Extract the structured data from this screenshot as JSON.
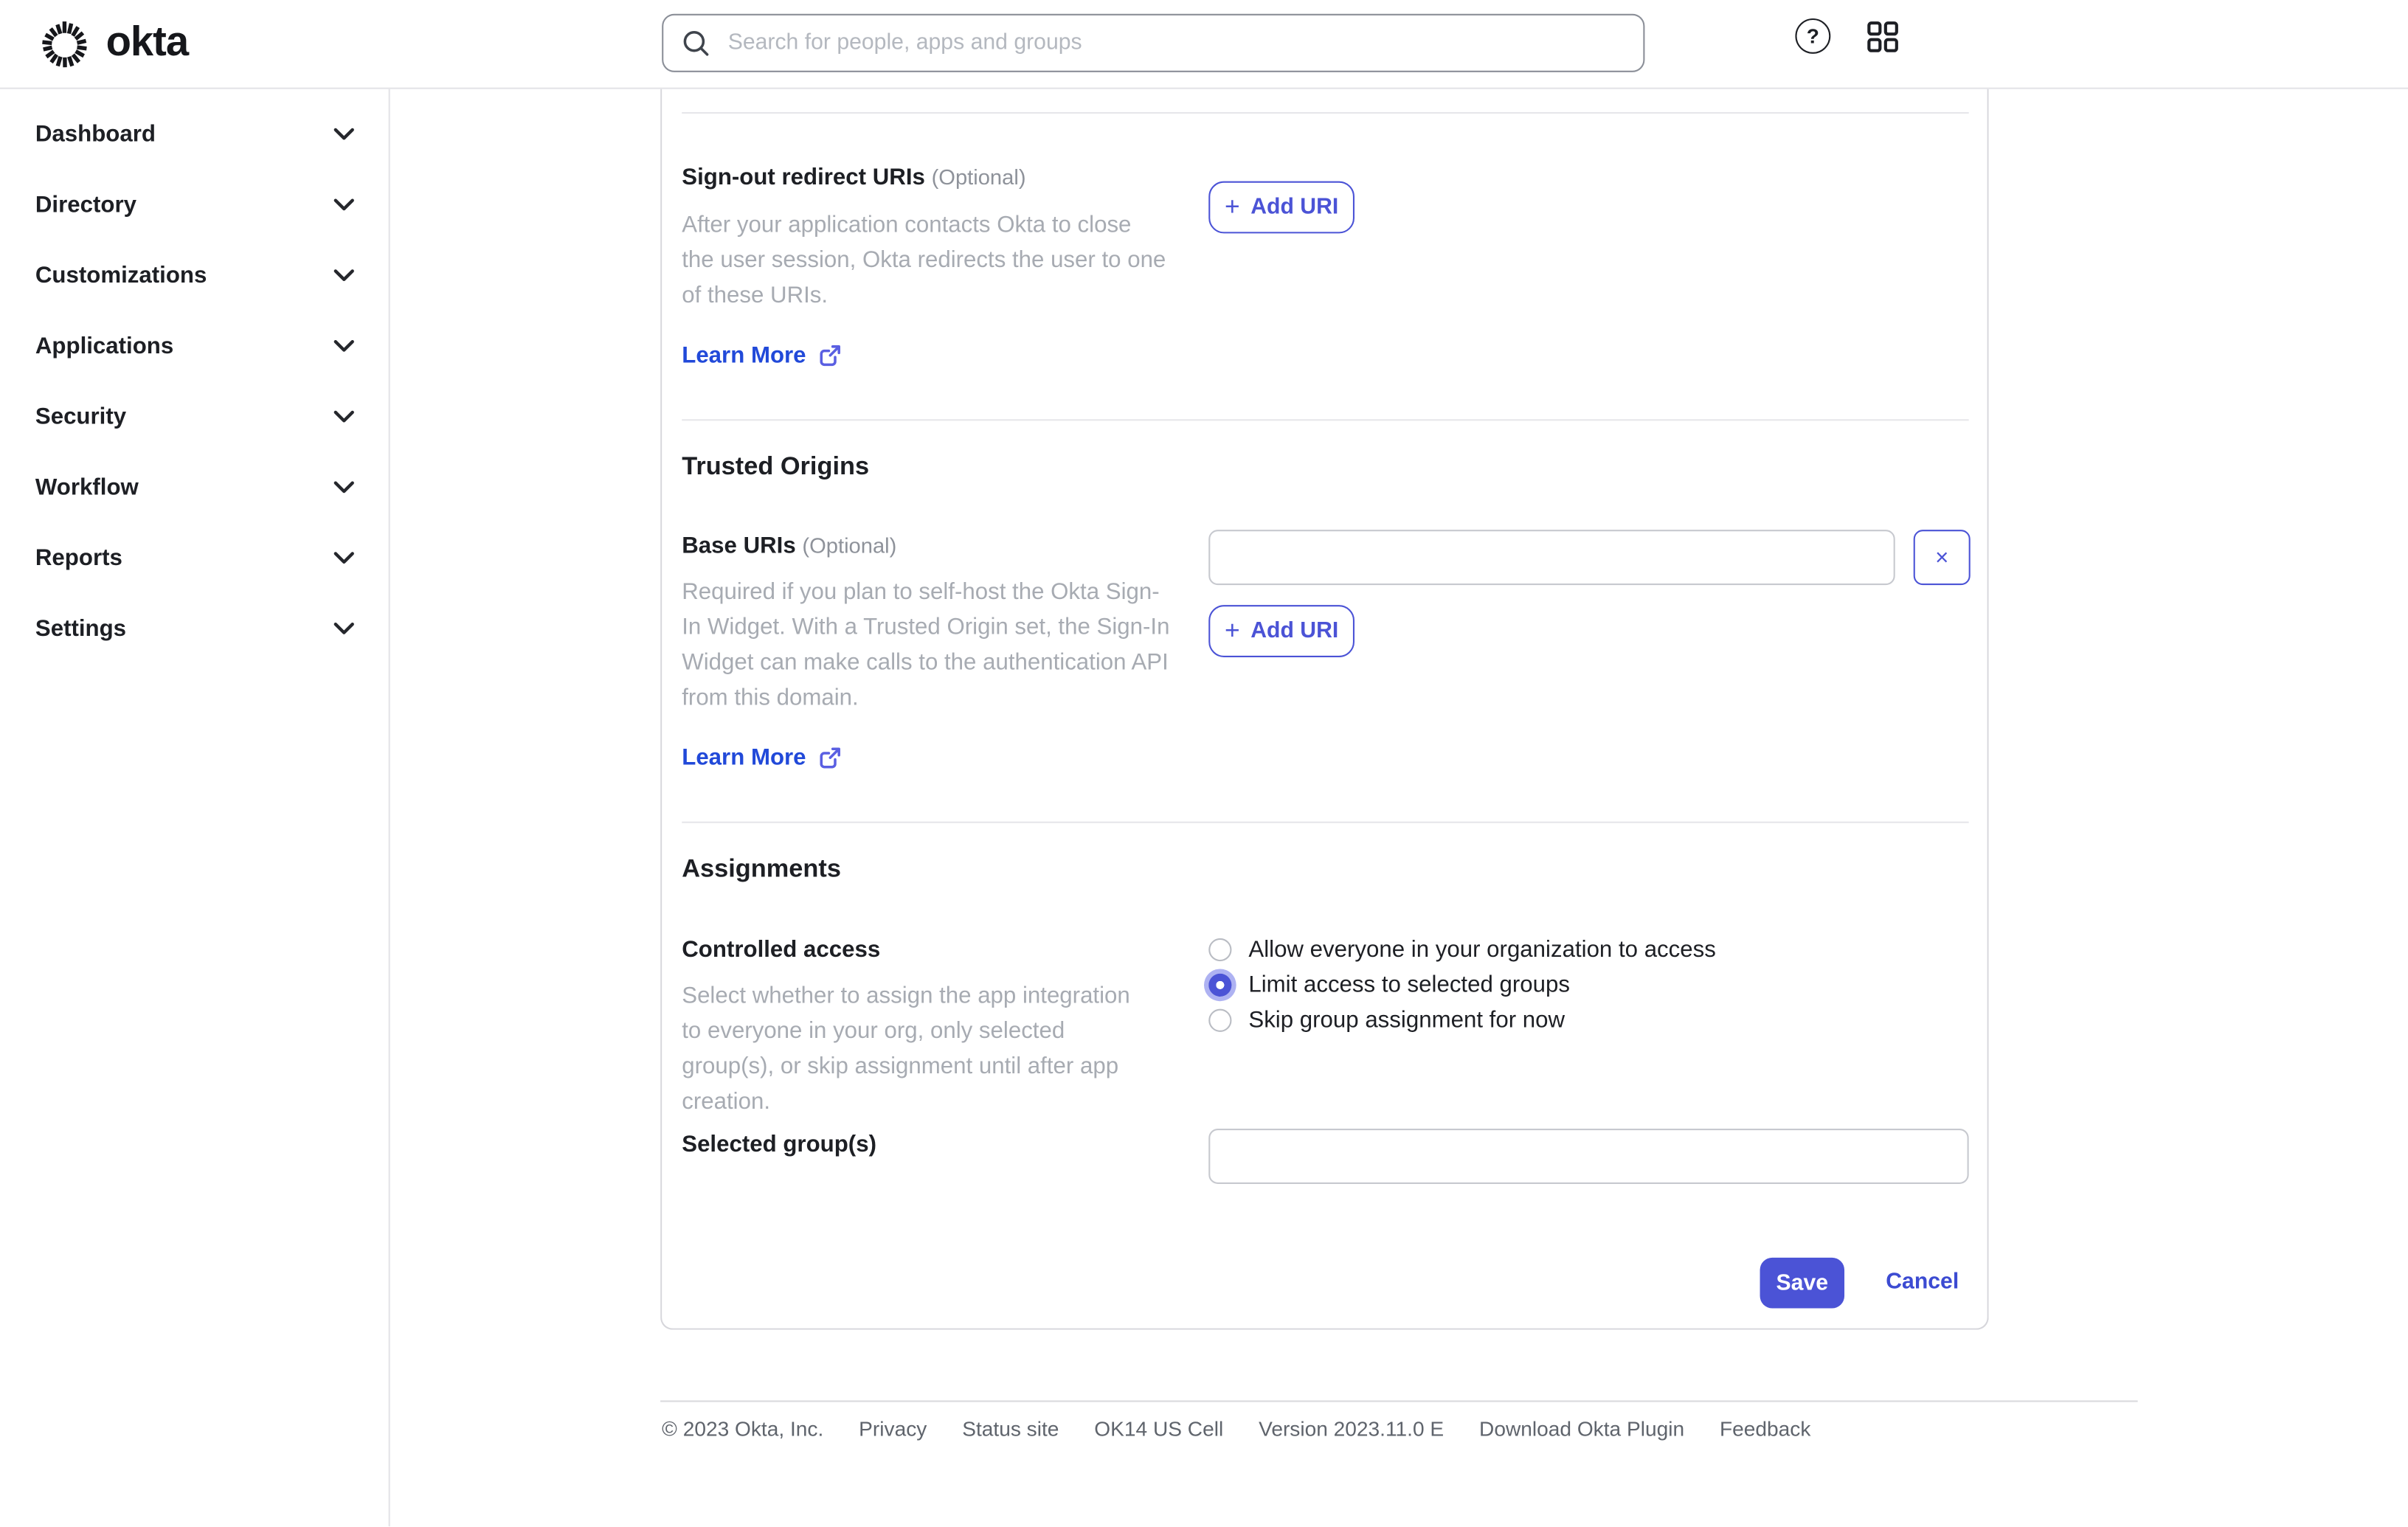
{
  "header": {
    "logo_text": "okta",
    "search_placeholder": "Search for people, apps and groups",
    "help_glyph": "?"
  },
  "sidebar": {
    "items": [
      {
        "label": "Dashboard"
      },
      {
        "label": "Directory"
      },
      {
        "label": "Customizations"
      },
      {
        "label": "Applications"
      },
      {
        "label": "Security"
      },
      {
        "label": "Workflow"
      },
      {
        "label": "Reports"
      },
      {
        "label": "Settings"
      }
    ]
  },
  "icons": {
    "plus": "+",
    "close": "×"
  },
  "main": {
    "signout": {
      "label": "Sign-out redirect URIs",
      "optional": "(Optional)",
      "description": "After your application contacts Okta to close the user session, Okta redirects the user to one of these URIs.",
      "learn_more": "Learn More",
      "add_uri_label": "Add URI"
    },
    "trusted_origins": {
      "heading": "Trusted Origins",
      "base_uris": {
        "label": "Base URIs",
        "optional": "(Optional)",
        "value": "",
        "description": "Required if you plan to self-host the Okta Sign-In Widget. With a Trusted Origin set, the Sign-In Widget can make calls to the authentication API from this domain.",
        "learn_more": "Learn More",
        "add_uri_label": "Add URI"
      }
    },
    "assignments": {
      "heading": "Assignments",
      "controlled_access": {
        "label": "Controlled access",
        "description": "Select whether to assign the app integration to everyone in your org, only selected group(s), or skip assignment until after app creation.",
        "options": [
          {
            "label": "Allow everyone in your organization to access",
            "selected": false
          },
          {
            "label": "Limit access to selected groups",
            "selected": true
          },
          {
            "label": "Skip group assignment for now",
            "selected": false
          }
        ]
      },
      "selected_groups": {
        "label": "Selected group(s)",
        "value": ""
      }
    },
    "actions": {
      "save": "Save",
      "cancel": "Cancel"
    }
  },
  "footer": {
    "items": [
      "© 2023 Okta, Inc.",
      "Privacy",
      "Status site",
      "OK14 US Cell",
      "Version 2023.11.0 E",
      "Download Okta Plugin",
      "Feedback"
    ]
  },
  "colors": {
    "primary_indigo": "#4b53d6",
    "link_blue": "#2149d9",
    "text_dark": "#1d1f24",
    "text_muted": "#a7abb2",
    "border_gray": "#d6d6db"
  }
}
